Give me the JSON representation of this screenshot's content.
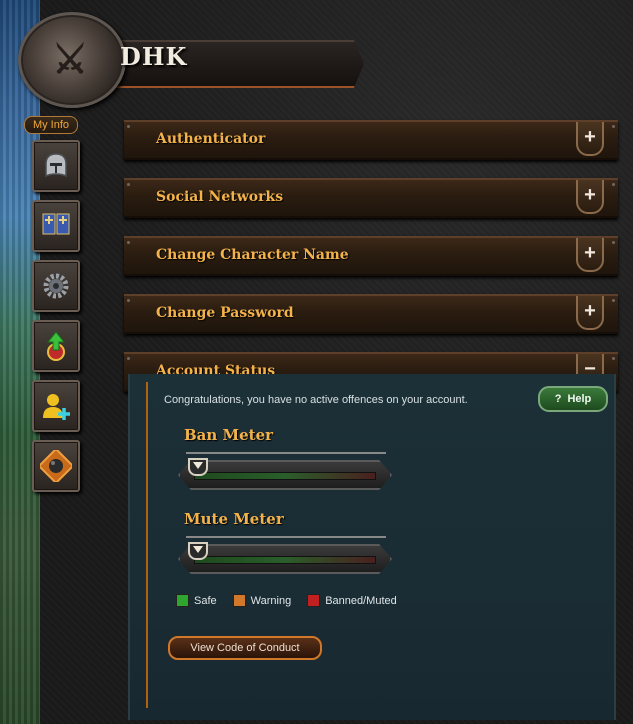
{
  "profile": {
    "username": "DHK",
    "emblem_icon": "shield-crest-icon"
  },
  "sidebar": {
    "my_info_label": "My Info",
    "items": [
      {
        "name": "helmet",
        "icon": "helmet-icon"
      },
      {
        "name": "banners",
        "icon": "banner-icon"
      },
      {
        "name": "settings",
        "icon": "gear-icon"
      },
      {
        "name": "levels",
        "icon": "level-up-icon"
      },
      {
        "name": "add-friend",
        "icon": "add-user-icon"
      },
      {
        "name": "bomb",
        "icon": "bomb-icon"
      }
    ]
  },
  "sections": [
    {
      "title": "Authenticator",
      "toggle": "+"
    },
    {
      "title": "Social Networks",
      "toggle": "+"
    },
    {
      "title": "Change Character Name",
      "toggle": "+"
    },
    {
      "title": "Change Password",
      "toggle": "+"
    },
    {
      "title": "Account Status",
      "toggle": "−"
    }
  ],
  "account_status": {
    "message": "Congratulations, you have no active offences on your account.",
    "help_label": "Help",
    "help_icon_text": "?",
    "ban_meter": {
      "label": "Ban Meter",
      "value": 0
    },
    "mute_meter": {
      "label": "Mute Meter",
      "value": 0
    },
    "legend": [
      {
        "label": "Safe",
        "color": "#2ea52e"
      },
      {
        "label": "Warning",
        "color": "#d2782a"
      },
      {
        "label": "Banned/Muted",
        "color": "#c02020"
      }
    ],
    "code_of_conduct_label": "View Code of Conduct"
  },
  "colors": {
    "accent_orange": "#f3b24a",
    "panel_teal": "#1c3038"
  }
}
